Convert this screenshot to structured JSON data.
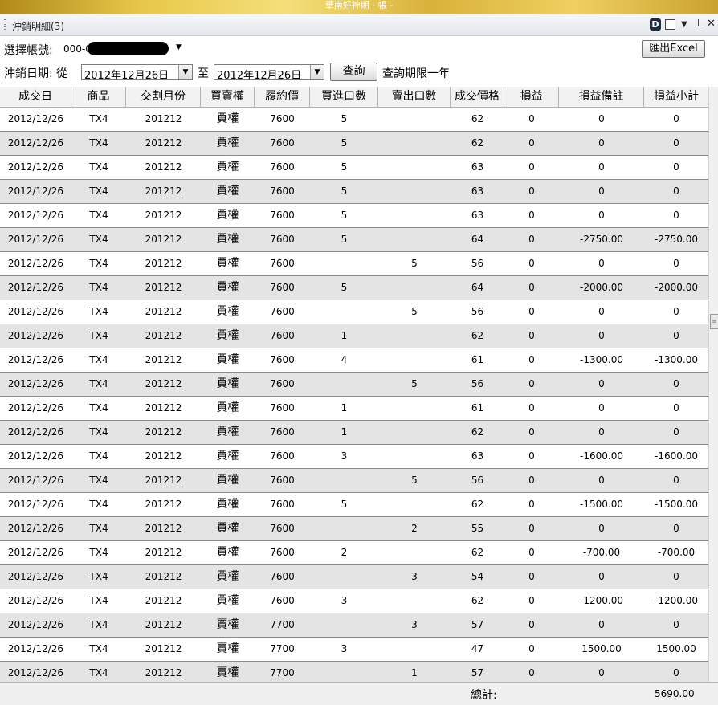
{
  "window": {
    "title": "華南好神期 - 帳 -"
  },
  "pane": {
    "title": "沖銷明細(3)",
    "d_label": "D"
  },
  "toolbar": {
    "account_label": "選擇帳號:",
    "account_value": "000-0",
    "date_label": "沖銷日期: 從",
    "from_date": "2012年12月26日",
    "to_label": "至",
    "to_date": "2012年12月26日",
    "query_label": "查詢",
    "limit_note": "查詢期限一年",
    "export_label": "匯出Excel"
  },
  "columns": [
    "成交日",
    "商品",
    "交割月份",
    "買賣權",
    "履約價",
    "買進口數",
    "賣出口數",
    "成交價格",
    "損益",
    "損益備註",
    "損益小計"
  ],
  "rows": [
    [
      "2012/12/26",
      "TX4",
      "201212",
      "買權",
      "7600",
      "5",
      "",
      "62",
      "0",
      "0",
      "0"
    ],
    [
      "2012/12/26",
      "TX4",
      "201212",
      "買權",
      "7600",
      "5",
      "",
      "62",
      "0",
      "0",
      "0"
    ],
    [
      "2012/12/26",
      "TX4",
      "201212",
      "買權",
      "7600",
      "5",
      "",
      "63",
      "0",
      "0",
      "0"
    ],
    [
      "2012/12/26",
      "TX4",
      "201212",
      "買權",
      "7600",
      "5",
      "",
      "63",
      "0",
      "0",
      "0"
    ],
    [
      "2012/12/26",
      "TX4",
      "201212",
      "買權",
      "7600",
      "5",
      "",
      "63",
      "0",
      "0",
      "0"
    ],
    [
      "2012/12/26",
      "TX4",
      "201212",
      "買權",
      "7600",
      "5",
      "",
      "64",
      "0",
      "-2750.00",
      "-2750.00"
    ],
    [
      "2012/12/26",
      "TX4",
      "201212",
      "買權",
      "7600",
      "",
      "5",
      "56",
      "0",
      "0",
      "0"
    ],
    [
      "2012/12/26",
      "TX4",
      "201212",
      "買權",
      "7600",
      "5",
      "",
      "64",
      "0",
      "-2000.00",
      "-2000.00"
    ],
    [
      "2012/12/26",
      "TX4",
      "201212",
      "買權",
      "7600",
      "",
      "5",
      "56",
      "0",
      "0",
      "0"
    ],
    [
      "2012/12/26",
      "TX4",
      "201212",
      "買權",
      "7600",
      "1",
      "",
      "62",
      "0",
      "0",
      "0"
    ],
    [
      "2012/12/26",
      "TX4",
      "201212",
      "買權",
      "7600",
      "4",
      "",
      "61",
      "0",
      "-1300.00",
      "-1300.00"
    ],
    [
      "2012/12/26",
      "TX4",
      "201212",
      "買權",
      "7600",
      "",
      "5",
      "56",
      "0",
      "0",
      "0"
    ],
    [
      "2012/12/26",
      "TX4",
      "201212",
      "買權",
      "7600",
      "1",
      "",
      "61",
      "0",
      "0",
      "0"
    ],
    [
      "2012/12/26",
      "TX4",
      "201212",
      "買權",
      "7600",
      "1",
      "",
      "62",
      "0",
      "0",
      "0"
    ],
    [
      "2012/12/26",
      "TX4",
      "201212",
      "買權",
      "7600",
      "3",
      "",
      "63",
      "0",
      "-1600.00",
      "-1600.00"
    ],
    [
      "2012/12/26",
      "TX4",
      "201212",
      "買權",
      "7600",
      "",
      "5",
      "56",
      "0",
      "0",
      "0"
    ],
    [
      "2012/12/26",
      "TX4",
      "201212",
      "買權",
      "7600",
      "5",
      "",
      "62",
      "0",
      "-1500.00",
      "-1500.00"
    ],
    [
      "2012/12/26",
      "TX4",
      "201212",
      "買權",
      "7600",
      "",
      "2",
      "55",
      "0",
      "0",
      "0"
    ],
    [
      "2012/12/26",
      "TX4",
      "201212",
      "買權",
      "7600",
      "2",
      "",
      "62",
      "0",
      "-700.00",
      "-700.00"
    ],
    [
      "2012/12/26",
      "TX4",
      "201212",
      "買權",
      "7600",
      "",
      "3",
      "54",
      "0",
      "0",
      "0"
    ],
    [
      "2012/12/26",
      "TX4",
      "201212",
      "買權",
      "7600",
      "3",
      "",
      "62",
      "0",
      "-1200.00",
      "-1200.00"
    ],
    [
      "2012/12/26",
      "TX4",
      "201212",
      "賣權",
      "7700",
      "",
      "3",
      "57",
      "0",
      "0",
      "0"
    ],
    [
      "2012/12/26",
      "TX4",
      "201212",
      "賣權",
      "7700",
      "3",
      "",
      "47",
      "0",
      "1500.00",
      "1500.00"
    ],
    [
      "2012/12/26",
      "TX4",
      "201212",
      "賣權",
      "7700",
      "",
      "1",
      "57",
      "0",
      "0",
      "0"
    ]
  ],
  "footer": {
    "total_label": "總計:",
    "total_value": "5690.00"
  }
}
